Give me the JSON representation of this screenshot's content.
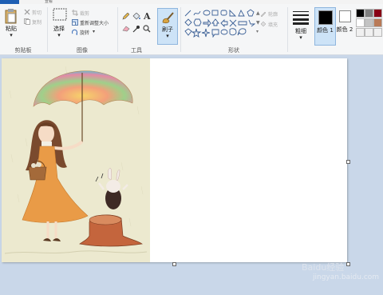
{
  "tabs": {
    "file": "",
    "view": "查看"
  },
  "clipboard": {
    "paste": "粘贴",
    "cut": "剪切",
    "copy": "复制",
    "group": "剪贴板"
  },
  "image": {
    "select": "选择",
    "crop": "裁剪",
    "resize": "重新调整大小",
    "rotate": "旋转",
    "group": "图像"
  },
  "tools": {
    "group": "工具",
    "text_glyph": "A"
  },
  "brush": {
    "label": "刷子"
  },
  "shapes": {
    "group": "形状",
    "outline": "轮廓",
    "fill": "填充"
  },
  "size": {
    "label": "粗细"
  },
  "colors": {
    "color1": "颜色 1",
    "color2": "颜色 2",
    "color1_value": "#000000",
    "color2_value": "#ffffff",
    "palette": [
      "#000000",
      "#7f7f7f",
      "#880015",
      "#ffffff",
      "#c3c3c3",
      "#b97a57",
      "#f0f0f0",
      "#f0f0f0",
      "#f0f0f0"
    ]
  },
  "watermark": {
    "main": "Baidu经验",
    "sub": "jingyan.baidu.com"
  }
}
